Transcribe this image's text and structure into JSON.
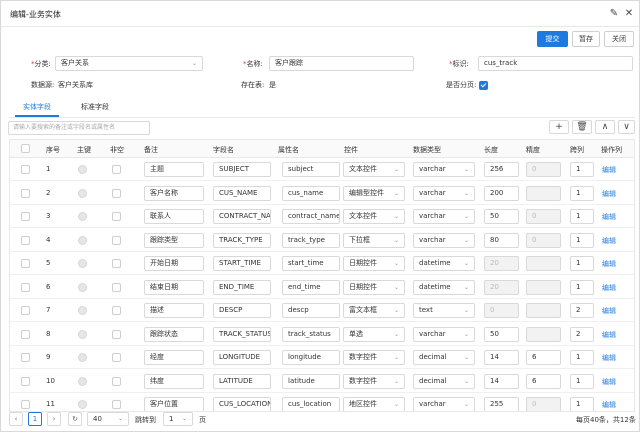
{
  "window": {
    "title": "编辑-业务实体",
    "pin_icon": "pin-icon",
    "close_icon": "close-icon"
  },
  "toolbar": {
    "submit": "提交",
    "save": "暂存",
    "close": "关闭"
  },
  "form": {
    "category_label": "分类:",
    "category_value": "客户关系",
    "name_label": "名称:",
    "name_value": "客户跟踪",
    "id_label": "标识:",
    "id_value": "cus_track",
    "datasource_label": "数据源:",
    "datasource_value": "客户关系库",
    "exists_label": "存在表:",
    "exists_value": "是",
    "paging_label": "是否分页:",
    "paging_checked": true
  },
  "tabs": [
    "实体字段",
    "标准字段"
  ],
  "search": {
    "placeholder": "请输入要搜索的备注或字段名或属性名"
  },
  "tools": {
    "add": "+",
    "delete": "🗑",
    "up": "∧",
    "down": "∨"
  },
  "columns": [
    "序号",
    "主键",
    "非空",
    "备注",
    "字段名",
    "属性名",
    "控件",
    "数据类型",
    "长度",
    "精度",
    "跨列",
    "操作列"
  ],
  "rows": [
    {
      "n": "1",
      "remark": "主题",
      "field": "SUBJECT",
      "prop": "subject",
      "ctrl": "文本控件",
      "type": "varchar",
      "len": "256",
      "len_dis": false,
      "prec": "0",
      "prec_dis": true,
      "span": "1",
      "op": "编辑"
    },
    {
      "n": "2",
      "remark": "客户名称",
      "field": "CUS_NAME",
      "prop": "cus_name",
      "ctrl": "编辑型控件",
      "type": "varchar",
      "len": "200",
      "len_dis": false,
      "prec": "",
      "prec_dis": true,
      "span": "1",
      "op": "编辑"
    },
    {
      "n": "3",
      "remark": "联系人",
      "field": "CONTRACT_NAME",
      "prop": "contract_name",
      "ctrl": "文本控件",
      "type": "varchar",
      "len": "50",
      "len_dis": false,
      "prec": "0",
      "prec_dis": true,
      "span": "1",
      "op": "编辑"
    },
    {
      "n": "4",
      "remark": "跟踪类型",
      "field": "TRACK_TYPE",
      "prop": "track_type",
      "ctrl": "下拉框",
      "type": "varchar",
      "len": "80",
      "len_dis": false,
      "prec": "0",
      "prec_dis": true,
      "span": "1",
      "op": "编辑"
    },
    {
      "n": "5",
      "remark": "开始日期",
      "field": "START_TIME",
      "prop": "start_time",
      "ctrl": "日期控件",
      "type": "datetime",
      "len": "20",
      "len_dis": true,
      "prec": "",
      "prec_dis": true,
      "span": "1",
      "op": "编辑"
    },
    {
      "n": "6",
      "remark": "结束日期",
      "field": "END_TIME",
      "prop": "end_time",
      "ctrl": "日期控件",
      "type": "datetime",
      "len": "20",
      "len_dis": true,
      "prec": "",
      "prec_dis": true,
      "span": "1",
      "op": "编辑"
    },
    {
      "n": "7",
      "remark": "描述",
      "field": "DESCP",
      "prop": "descp",
      "ctrl": "富文本框",
      "type": "text",
      "len": "0",
      "len_dis": true,
      "prec": "",
      "prec_dis": true,
      "span": "2",
      "op": "编辑"
    },
    {
      "n": "8",
      "remark": "跟踪状态",
      "field": "TRACK_STATUS",
      "prop": "track_status",
      "ctrl": "单选",
      "type": "varchar",
      "len": "50",
      "len_dis": false,
      "prec": "",
      "prec_dis": true,
      "span": "2",
      "op": "编辑"
    },
    {
      "n": "9",
      "remark": "经度",
      "field": "LONGITUDE",
      "prop": "longitude",
      "ctrl": "数字控件",
      "type": "decimal",
      "len": "14",
      "len_dis": false,
      "prec": "6",
      "prec_dis": false,
      "span": "1",
      "op": "编辑"
    },
    {
      "n": "10",
      "remark": "纬度",
      "field": "LATITUDE",
      "prop": "latitude",
      "ctrl": "数字控件",
      "type": "decimal",
      "len": "14",
      "len_dis": false,
      "prec": "6",
      "prec_dis": false,
      "span": "1",
      "op": "编辑"
    },
    {
      "n": "11",
      "remark": "客户位置",
      "field": "CUS_LOCATION",
      "prop": "cus_location",
      "ctrl": "地区控件",
      "type": "varchar",
      "len": "255",
      "len_dis": false,
      "prec": "0",
      "prec_dis": true,
      "span": "1",
      "op": "编辑"
    }
  ],
  "footer": {
    "page": "1",
    "page_size": "40",
    "jump_label": "跳转到",
    "jump_value": "1",
    "page_unit": "页",
    "summary": "每页40条，共12条"
  }
}
